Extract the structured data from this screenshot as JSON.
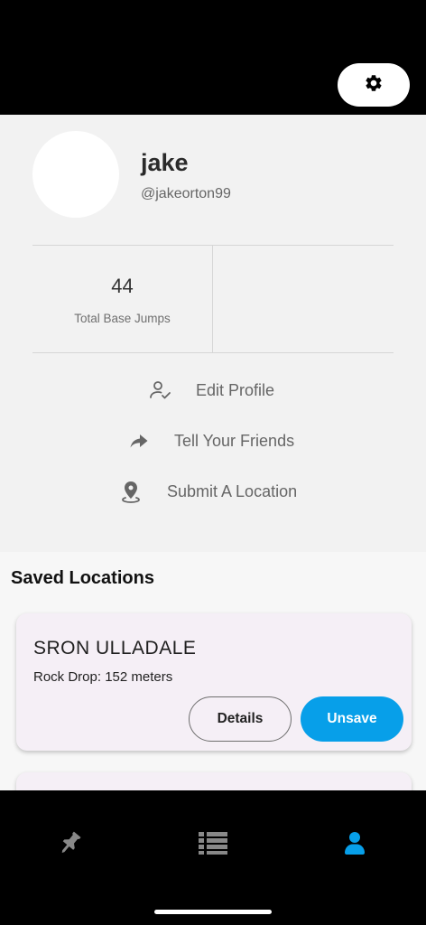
{
  "header": {
    "settings_icon": "gear-icon"
  },
  "profile": {
    "name": "jake",
    "handle": "@jakeorton99"
  },
  "stats": [
    {
      "value": "44",
      "label": "Total Base Jumps"
    }
  ],
  "actions": [
    {
      "label": "Edit Profile",
      "icon": "user-check-icon"
    },
    {
      "label": "Tell Your Friends",
      "icon": "share-arrow-icon"
    },
    {
      "label": "Submit A Location",
      "icon": "map-pin-icon"
    }
  ],
  "saved": {
    "title": "Saved Locations",
    "items": [
      {
        "name": "SRON ULLADALE",
        "detail": "Rock Drop: 152 meters",
        "details_label": "Details",
        "unsave_label": "Unsave"
      }
    ]
  },
  "nav": {
    "items": [
      {
        "icon": "pushpin-icon",
        "active": false
      },
      {
        "icon": "list-icon",
        "active": false
      },
      {
        "icon": "user-icon",
        "active": true
      }
    ]
  },
  "colors": {
    "accent": "#079fe9",
    "nav_inactive": "#888888"
  }
}
